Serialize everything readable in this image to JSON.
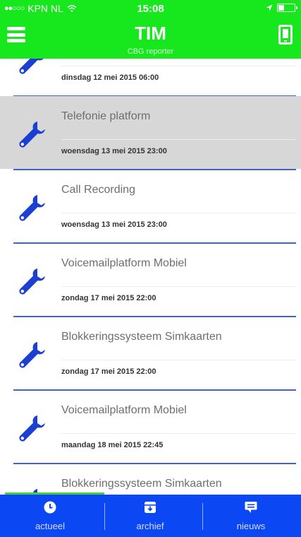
{
  "status_bar": {
    "carrier": "KPN NL",
    "time": "15:08",
    "battery_level": 0.35
  },
  "header": {
    "title": "TIM",
    "subtitle": "CBG reporter",
    "menu_icon": "hamburger-menu-icon",
    "device_icon": "device-icon"
  },
  "colors": {
    "header_bg": "#17e81e",
    "tabbar_bg": "#0b47f2",
    "divider": "#3d64d6",
    "wrench": "#1a3fd1",
    "selected_row_bg": "#d7d7d7"
  },
  "list": {
    "items": [
      {
        "name": "",
        "date": "dinsdag 12 mei 2015 06:00",
        "icon": "wrench-icon",
        "selected": false
      },
      {
        "name": "Telefonie platform",
        "date": "woensdag 13 mei 2015 23:00",
        "icon": "wrench-icon",
        "selected": true
      },
      {
        "name": "Call Recording",
        "date": "woensdag 13 mei 2015 23:00",
        "icon": "wrench-icon",
        "selected": false
      },
      {
        "name": "Voicemailplatform Mobiel",
        "date": "zondag 17 mei 2015 22:00",
        "icon": "wrench-icon",
        "selected": false
      },
      {
        "name": "Blokkeringssysteem Simkaarten",
        "date": "zondag 17 mei 2015 22:00",
        "icon": "wrench-icon",
        "selected": false
      },
      {
        "name": "Voicemailplatform Mobiel",
        "date": "maandag 18 mei 2015 22:45",
        "icon": "wrench-icon",
        "selected": false
      },
      {
        "name": "Blokkeringssysteem Simkaarten",
        "date": "",
        "icon": "wrench-icon",
        "selected": false
      }
    ]
  },
  "tabbar": {
    "load_progress": 0.33,
    "tabs": [
      {
        "label": "actueel",
        "icon": "clock-icon"
      },
      {
        "label": "archief",
        "icon": "archive-box-icon"
      },
      {
        "label": "nieuws",
        "icon": "chat-bubble-icon"
      }
    ]
  }
}
